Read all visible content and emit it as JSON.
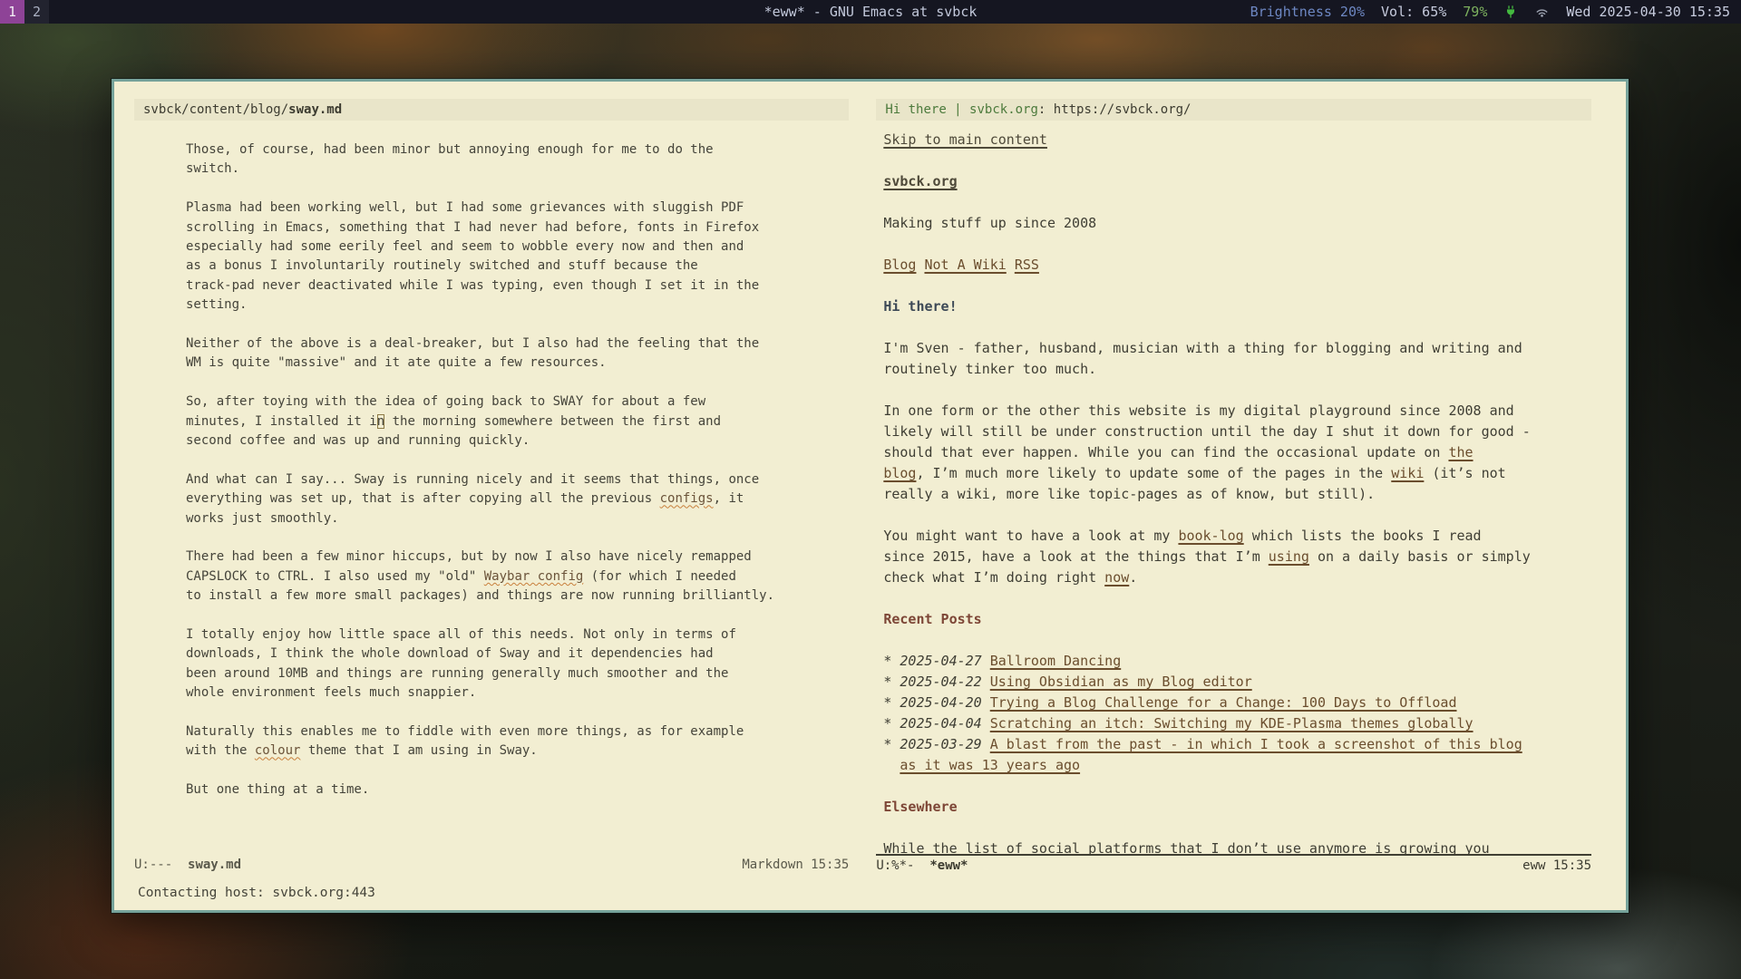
{
  "colors": {
    "workspace_active": "#8e4397",
    "brightness_blue": "#6d87c2",
    "battery_green": "#7cb05e",
    "plug_green": "#43b93f",
    "frame_border_teal": "#76a39b",
    "emacs_background": "#f2eed2",
    "header_line_bg": "#e9e5c9",
    "link_brown": "#6b4e2e",
    "heading_maroon": "#7d4636",
    "heading_slate": "#3d4956",
    "eww_title_green": "#4c7a3c"
  },
  "topbar": {
    "workspaces": [
      {
        "label": "1",
        "active": true
      },
      {
        "label": "2",
        "active": false
      }
    ],
    "title": "*eww* - GNU Emacs at svbck",
    "status": {
      "brightness": "Brightness 20%",
      "volume": "Vol: 65%",
      "battery": "79%",
      "battery_icon": "plug-charging-icon",
      "wifi_icon": "wifi-icon",
      "clock": "Wed 2025-04-30 15:35"
    }
  },
  "left_window": {
    "header_path": "svbck/content/blog/",
    "header_file": "sway.md",
    "modeline": {
      "flags": "U:---",
      "buffer": "sway.md",
      "mode_info": "Markdown 15:35"
    },
    "paragraphs": [
      [
        [
          {
            "s": "p",
            "t": "Those, of course, had been minor but annoying enough for me to do the"
          }
        ],
        [
          {
            "s": "p",
            "t": "switch."
          }
        ]
      ],
      [
        [
          {
            "s": "p",
            "t": "Plasma had been working well, but I had some grievances with sluggish PDF"
          }
        ],
        [
          {
            "s": "p",
            "t": "scrolling in Emacs, something that I had never had before, fonts in Firefox"
          }
        ],
        [
          {
            "s": "p",
            "t": "especially had some eerily feel and seem to wobble every now and then and"
          }
        ],
        [
          {
            "s": "p",
            "t": "as a bonus I involuntarily routinely switched and stuff because the"
          }
        ],
        [
          {
            "s": "p",
            "t": "track-pad never deactivated while I was typing, even though I set it in the"
          }
        ],
        [
          {
            "s": "p",
            "t": "setting."
          }
        ]
      ],
      [
        [
          {
            "s": "p",
            "t": "Neither of the above is a deal-breaker, but I also had the feeling that the"
          }
        ],
        [
          {
            "s": "p",
            "t": "WM is quite \"massive\" and it ate quite a few resources."
          }
        ]
      ],
      [
        [
          {
            "s": "p",
            "t": "So, after toying with the idea of going back to SWAY for about a few"
          }
        ],
        [
          {
            "s": "p",
            "t": "minutes, I installed it i"
          },
          {
            "s": "cur",
            "t": "n"
          },
          {
            "s": "p",
            "t": " the morning somewhere between the first and"
          }
        ],
        [
          {
            "s": "p",
            "t": "second coffee and was up and running quickly."
          }
        ]
      ],
      [
        [
          {
            "s": "p",
            "t": "And what can I say... Sway is running nicely and it seems that things, once"
          }
        ],
        [
          {
            "s": "p",
            "t": "everything was set up, that is after copying all the previous "
          },
          {
            "s": "sq",
            "t": "configs"
          },
          {
            "s": "p",
            "t": ", it"
          }
        ],
        [
          {
            "s": "p",
            "t": "works just smoothly."
          }
        ]
      ],
      [
        [
          {
            "s": "p",
            "t": "There had been a few minor hiccups, but by now I also have nicely remapped"
          }
        ],
        [
          {
            "s": "p",
            "t": "CAPSLOCK to CTRL. I also used my \"old\" "
          },
          {
            "s": "sq",
            "t": "Waybar config"
          },
          {
            "s": "p",
            "t": " (for which I needed"
          }
        ],
        [
          {
            "s": "p",
            "t": "to install a few more small packages) and things are now running brilliantly."
          }
        ]
      ],
      [
        [
          {
            "s": "p",
            "t": "I totally enjoy how little space all of this needs. Not only in terms of"
          }
        ],
        [
          {
            "s": "p",
            "t": "downloads, I think the whole download of Sway and it dependencies had"
          }
        ],
        [
          {
            "s": "p",
            "t": "been around 10MB and things are running generally much smoother and the"
          }
        ],
        [
          {
            "s": "p",
            "t": "whole environment feels much snappier."
          }
        ]
      ],
      [
        [
          {
            "s": "p",
            "t": "Naturally this enables me to fiddle with even more things, as for example"
          }
        ],
        [
          {
            "s": "p",
            "t": "with the "
          },
          {
            "s": "sq",
            "t": "colour"
          },
          {
            "s": "p",
            "t": " theme that I am using in Sway."
          }
        ]
      ],
      [
        [
          {
            "s": "p",
            "t": "But one thing at a time."
          }
        ]
      ]
    ]
  },
  "right_window": {
    "header_title": "Hi there | svbck.org",
    "header_rest": ": https://svbck.org/",
    "modeline": {
      "flags": "U:%*-",
      "buffer": "*eww*",
      "mode_info": "eww 15:35"
    },
    "lines": [
      [
        {
          "s": "link2",
          "t": "Skip to main content"
        }
      ],
      [],
      [
        {
          "s": "blink",
          "t": "svbck.org"
        }
      ],
      [],
      [
        {
          "s": "p",
          "t": "Making stuff up since 2008"
        }
      ],
      [],
      [
        {
          "s": "link",
          "t": "Blog"
        },
        {
          "s": "p",
          "t": " "
        },
        {
          "s": "link",
          "t": "Not A Wiki"
        },
        {
          "s": "p",
          "t": " "
        },
        {
          "s": "link",
          "t": "RSS"
        }
      ],
      [],
      [
        {
          "s": "h1",
          "t": "Hi there!"
        }
      ],
      [],
      [
        {
          "s": "p",
          "t": "I'm Sven - father, husband, musician with a thing for blogging and writing and"
        }
      ],
      [
        {
          "s": "p",
          "t": "routinely tinker too much."
        }
      ],
      [],
      [
        {
          "s": "p",
          "t": "In one form or the other this website is my digital playground since 2008 and"
        }
      ],
      [
        {
          "s": "p",
          "t": "likely will still be under construction until the day I shut it down for good -"
        }
      ],
      [
        {
          "s": "p",
          "t": "should that ever happen. While you can find the occasional update on "
        },
        {
          "s": "link",
          "t": "the"
        }
      ],
      [
        {
          "s": "link",
          "t": "blog"
        },
        {
          "s": "p",
          "t": ", I’m much more likely to update some of the pages in the "
        },
        {
          "s": "link",
          "t": "wiki"
        },
        {
          "s": "p",
          "t": " (it’s not"
        }
      ],
      [
        {
          "s": "p",
          "t": "really a wiki, more like topic-pages as of know, but still)."
        }
      ],
      [],
      [
        {
          "s": "p",
          "t": "You might want to have a look at my "
        },
        {
          "s": "link",
          "t": "book-log"
        },
        {
          "s": "p",
          "t": " which lists the books I read"
        }
      ],
      [
        {
          "s": "p",
          "t": "since 2015, have a look at the things that I’m "
        },
        {
          "s": "link",
          "t": "using"
        },
        {
          "s": "p",
          "t": " on a daily basis or simply"
        }
      ],
      [
        {
          "s": "p",
          "t": "check what I’m doing right "
        },
        {
          "s": "link",
          "t": "now"
        },
        {
          "s": "p",
          "t": "."
        }
      ],
      [],
      [
        {
          "s": "h2",
          "t": "Recent Posts"
        }
      ],
      [],
      [
        {
          "s": "p",
          "t": "* "
        },
        {
          "s": "date",
          "t": "2025-04-27"
        },
        {
          "s": "p",
          "t": " "
        },
        {
          "s": "link",
          "t": "Ballroom Dancing"
        }
      ],
      [
        {
          "s": "p",
          "t": "* "
        },
        {
          "s": "date",
          "t": "2025-04-22"
        },
        {
          "s": "p",
          "t": " "
        },
        {
          "s": "link",
          "t": "Using Obsidian as my Blog editor"
        }
      ],
      [
        {
          "s": "p",
          "t": "* "
        },
        {
          "s": "date",
          "t": "2025-04-20"
        },
        {
          "s": "p",
          "t": " "
        },
        {
          "s": "link",
          "t": "Trying a Blog Challenge for a Change: 100 Days to Offload"
        }
      ],
      [
        {
          "s": "p",
          "t": "* "
        },
        {
          "s": "date",
          "t": "2025-04-04"
        },
        {
          "s": "p",
          "t": " "
        },
        {
          "s": "link",
          "t": "Scratching an itch: Switching my KDE-Plasma themes globally"
        }
      ],
      [
        {
          "s": "p",
          "t": "* "
        },
        {
          "s": "date",
          "t": "2025-03-29"
        },
        {
          "s": "p",
          "t": " "
        },
        {
          "s": "link",
          "t": "A blast from the past - in which I took a screenshot of this blog"
        }
      ],
      [
        {
          "s": "p",
          "t": "  "
        },
        {
          "s": "link",
          "t": "as it was 13 years ago"
        }
      ],
      [],
      [
        {
          "s": "h2",
          "t": "Elsewhere"
        }
      ],
      [],
      [
        {
          "s": "p",
          "t": "While the list of social platforms that I don’t use anymore is growing you"
        }
      ]
    ]
  },
  "echo_area": {
    "message": "Contacting host: svbck.org:443"
  }
}
